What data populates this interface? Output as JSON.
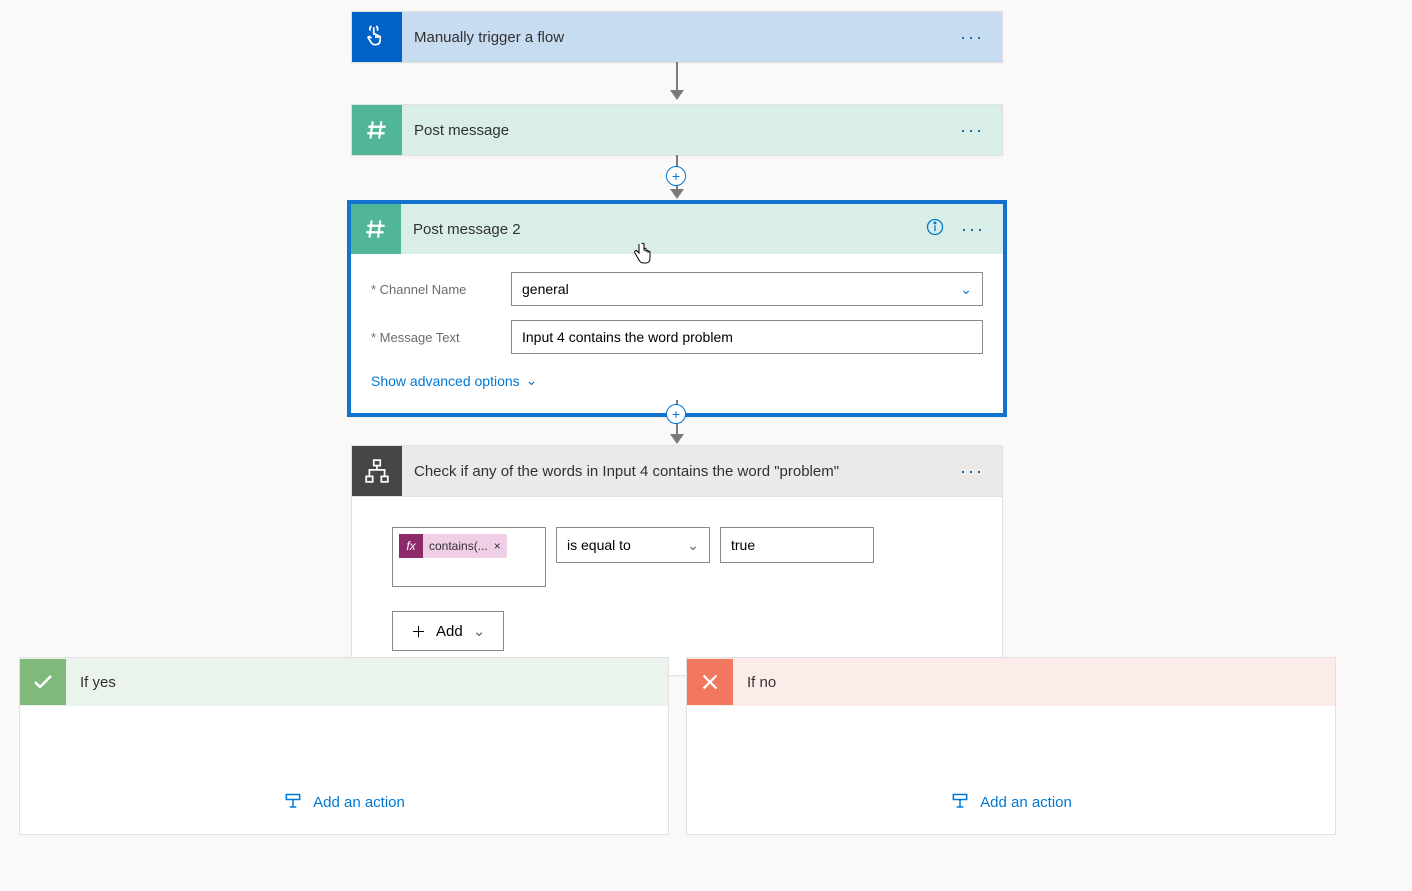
{
  "trigger": {
    "title": "Manually trigger a flow"
  },
  "post1": {
    "title": "Post message"
  },
  "post2": {
    "title": "Post message 2",
    "channel_label": "* Channel Name",
    "channel_value": "general",
    "message_label": "* Message Text",
    "message_value": "Input 4 contains the word problem",
    "advanced": "Show advanced options"
  },
  "condition": {
    "title": "Check if any of the words in Input 4 contains the word \"problem\"",
    "fx_label": "contains(...",
    "operator": "is equal to",
    "value": "true",
    "add_label": "Add"
  },
  "branches": {
    "yes_title": "If yes",
    "no_title": "If no",
    "add_action": "Add an action"
  }
}
